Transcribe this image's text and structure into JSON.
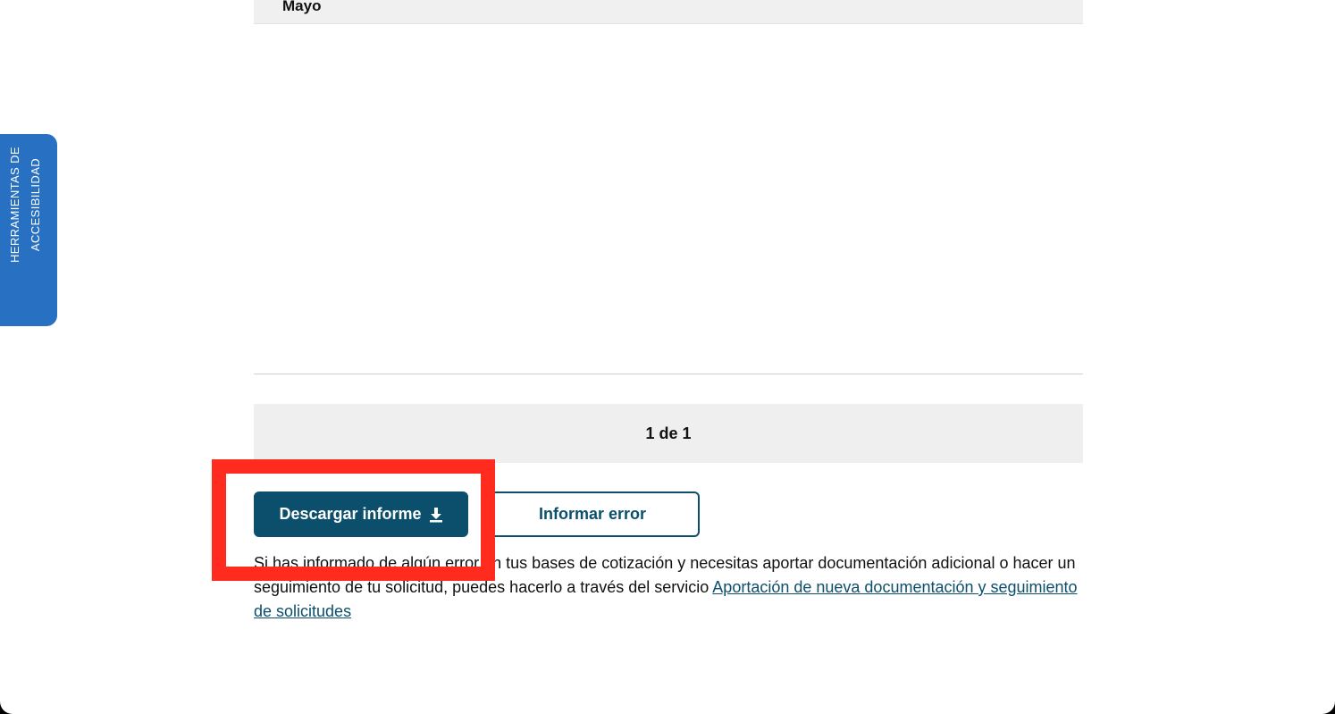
{
  "table": {
    "month_label": "Mayo"
  },
  "pagination": {
    "label": "1 de 1"
  },
  "actions": {
    "download_label": "Descargar informe",
    "report_error_label": "Informar error"
  },
  "info": {
    "text": "Si has informado de algún error en tus bases de cotización y necesitas aportar documentación adicional o hacer un seguimiento de tu solicitud, puedes hacerlo a través del servicio ",
    "link_text": "Aportación de nueva documentación y seguimiento de solicitudes"
  },
  "accessibility_tab": {
    "line1": "HERRAMIENTAS DE",
    "line2": "ACCESIBILIDAD",
    "icon": "accessibility-icon"
  },
  "colors": {
    "primary": "#0b4f6c",
    "highlight": "#ff2b1f",
    "a11y_tab": "#2870c2"
  }
}
